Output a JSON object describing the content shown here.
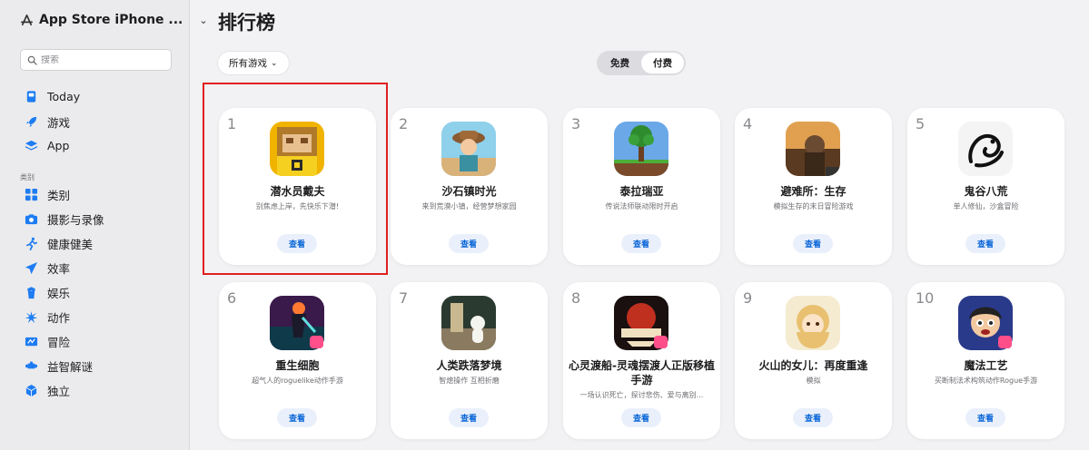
{
  "sidebar": {
    "app_title": "App Store iPhone ...",
    "search_placeholder": "搜索",
    "nav_top": [
      {
        "label": "Today",
        "icon": "today-icon"
      },
      {
        "label": "游戏",
        "icon": "rocket-icon"
      },
      {
        "label": "App",
        "icon": "layers-icon"
      }
    ],
    "section_label": "类别",
    "categories": [
      {
        "label": "类别",
        "icon": "grid-icon"
      },
      {
        "label": "摄影与录像",
        "icon": "camera-icon"
      },
      {
        "label": "健康健美",
        "icon": "running-icon"
      },
      {
        "label": "效率",
        "icon": "paperplane-icon"
      },
      {
        "label": "娱乐",
        "icon": "popcorn-icon"
      },
      {
        "label": "动作",
        "icon": "burst-icon"
      },
      {
        "label": "冒险",
        "icon": "map-icon"
      },
      {
        "label": "益智解谜",
        "icon": "puzzle-icon"
      },
      {
        "label": "独立",
        "icon": "cube-icon"
      }
    ]
  },
  "main": {
    "title": "排行榜",
    "filter_label": "所有游戏",
    "segments": [
      "免费",
      "付费"
    ],
    "cards": [
      {
        "rank": "1",
        "name": "潜水员戴夫",
        "sub": [
          "别焦虑上岸，先快乐下潜!"
        ],
        "button": "查看"
      },
      {
        "rank": "2",
        "name": "沙石镇时光",
        "sub": [
          "来到荒漠小镇，经营梦想家园"
        ],
        "button": "查看"
      },
      {
        "rank": "3",
        "name": "泰拉瑞亚",
        "sub": [
          "传说法师联动限时开启"
        ],
        "button": "查看"
      },
      {
        "rank": "4",
        "name": "避难所：生存",
        "sub": [
          "模拟生存的末日冒险游戏"
        ],
        "button": "查看"
      },
      {
        "rank": "5",
        "name": "鬼谷八荒",
        "sub": [
          "单人修仙，沙盒冒险"
        ],
        "button": "查看"
      },
      {
        "rank": "6",
        "name": "重生细胞",
        "sub": [
          "超气人的roguelike动作手游"
        ],
        "button": "查看"
      },
      {
        "rank": "7",
        "name": "人类跌落梦境",
        "sub": [
          "智熄操作 互相折磨"
        ],
        "button": "查看"
      },
      {
        "rank": "8",
        "name": "心灵渡船-灵魂摆渡人正版移植手游",
        "sub": [
          "一场认识死亡，探讨悲伤、爱与离别..."
        ],
        "button": "查看"
      },
      {
        "rank": "9",
        "name": "火山的女儿：再度重逢",
        "sub": [
          "模拟"
        ],
        "button": "查看"
      },
      {
        "rank": "10",
        "name": "魔法工艺",
        "sub": [
          "买断制法术构筑动作Rogue手游"
        ],
        "button": "查看"
      }
    ]
  },
  "colors": {
    "accent": "#0a66d8",
    "highlight_border": "#e02020",
    "sidebar_bg": "#ebebed",
    "page_bg": "#f2f2f4"
  }
}
